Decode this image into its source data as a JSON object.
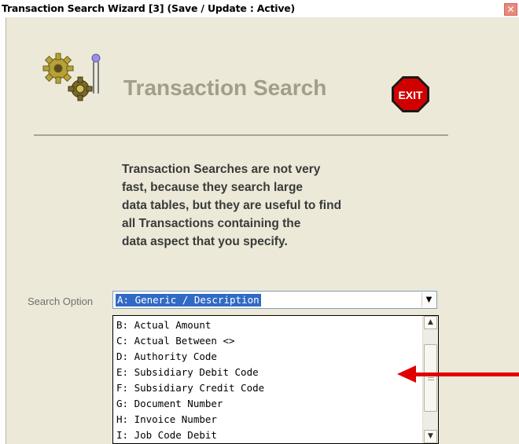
{
  "window": {
    "title": "Transaction Search Wizard [3]   (Save / Update : Active)",
    "close_glyph": "✕"
  },
  "header": {
    "heading": "Transaction Search",
    "exit_label": "EXIT",
    "logo_icon": "gears-icon"
  },
  "description": {
    "lines": [
      "Transaction Searches are not very",
      "fast, because they search large",
      "data tables, but they are useful to find",
      "all Transactions containing the",
      "data aspect that you specify."
    ]
  },
  "search": {
    "label": "Search Option",
    "selected": "A: Generic / Description",
    "arrow_glyph": "▼",
    "options": [
      "B: Actual Amount",
      "C: Actual Between <>",
      "D: Authority Code",
      "E: Subsidiary Debit Code",
      "F: Subsidiary Credit Code",
      "G: Document Number",
      "H: Invoice Number",
      "I: Job Code Debit"
    ]
  },
  "scrollbar": {
    "up_glyph": "▲",
    "down_glyph": "▼"
  },
  "colors": {
    "panel_bg": "#ece9d8",
    "heading": "#a39e88",
    "selection": "#316ac5",
    "annotation_arrow": "#e00000",
    "exit_sign": "#d10000"
  }
}
